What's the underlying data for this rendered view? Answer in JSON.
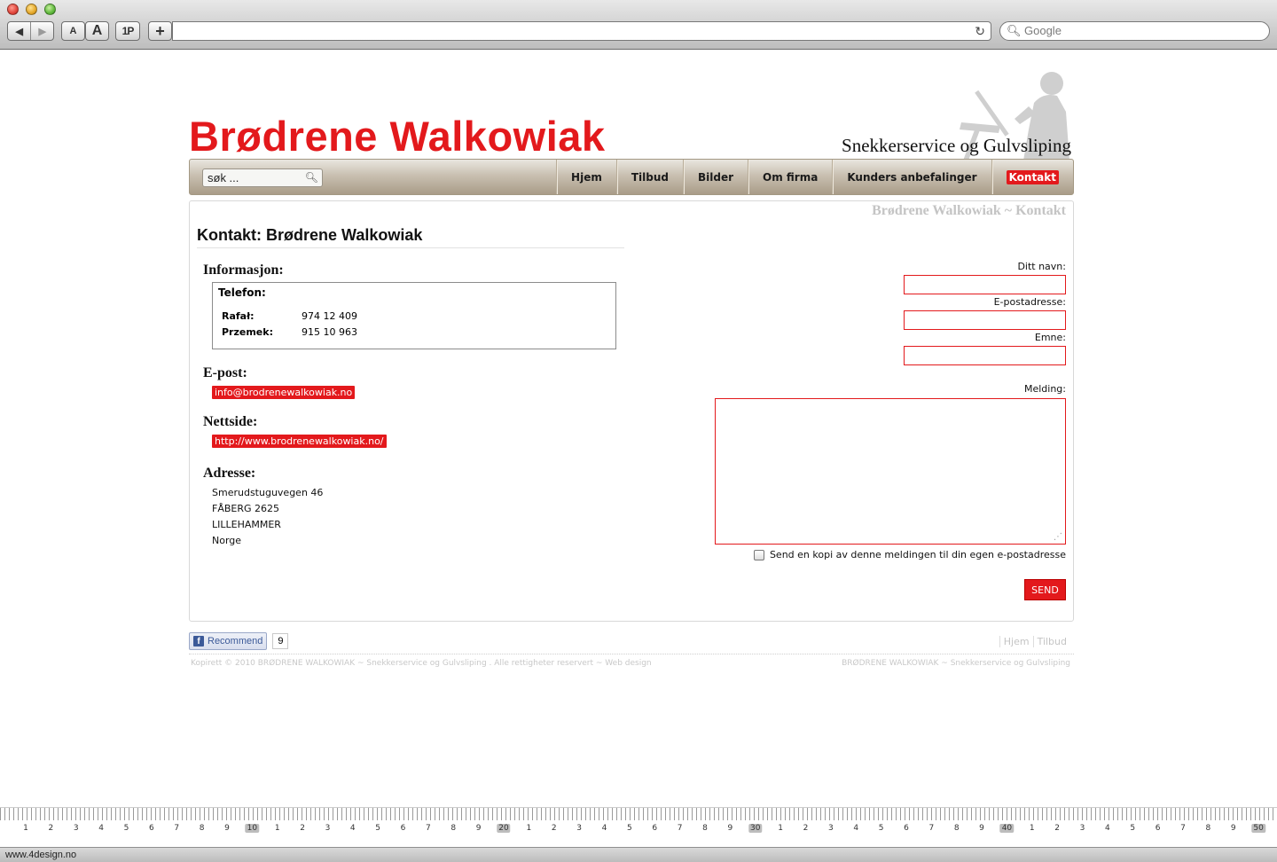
{
  "browser": {
    "search_placeholder": "Google",
    "text_smaller": "A",
    "text_bigger": "A",
    "onepassword": "1P",
    "new_tab": "+",
    "status_url": "www.4design.no"
  },
  "site": {
    "logo": "Brødrene Walkowiak",
    "tagline": "Snekkerservice og Gulvsliping",
    "search_value": "søk ...",
    "menu": [
      {
        "label": "Hjem",
        "active": false
      },
      {
        "label": "Tilbud",
        "active": false
      },
      {
        "label": "Bilder",
        "active": false
      },
      {
        "label": "Om firma",
        "active": false
      },
      {
        "label": "Kunders anbefalinger",
        "active": false
      },
      {
        "label": "Kontakt",
        "active": true
      }
    ],
    "accent_color": "#e3191c"
  },
  "content": {
    "breadcrumb": "Brødrene Walkowiak ~ Kontakt",
    "title": "Kontakt: Brødrene Walkowiak",
    "info_heading": "Informasjon:",
    "phone_heading": "Telefon:",
    "phones": [
      {
        "name": "Rafał:",
        "number": "974 12 409"
      },
      {
        "name": "Przemek:",
        "number": "915 10 963"
      }
    ],
    "email_heading": "E-post:",
    "email": "info@brodrenewalkowiak.no",
    "web_heading": "Nettside:",
    "website": "http://www.brodrenewalkowiak.no/",
    "address_heading": "Adresse:",
    "address_lines": [
      "Smerudstuguvegen 46",
      "FÅBERG 2625",
      "LILLEHAMMER",
      "Norge"
    ]
  },
  "form": {
    "name_label": "Ditt navn:",
    "email_label": "E-postadresse:",
    "subject_label": "Emne:",
    "message_label": "Melding:",
    "copy_label": "Send en kopi av denne meldingen til din egen e-postadresse",
    "send_label": "SEND"
  },
  "footer": {
    "fb_label": "Recommend",
    "fb_count": "9",
    "nav": [
      "Hjem",
      "Tilbud"
    ],
    "left": "Kopirett © 2010  BRØDRENE WALKOWIAK  ~  Snekkerservice og Gulvsliping . Alle rettigheter reservert  ~  Web design",
    "right": "BRØDRENE WALKOWIAK  ~  Snekkerservice og Gulvsliping"
  },
  "ruler": {
    "labels": [
      "1",
      "2",
      "3",
      "4",
      "5",
      "6",
      "7",
      "8",
      "9",
      "10",
      "1",
      "2",
      "3",
      "4",
      "5",
      "6",
      "7",
      "8",
      "9",
      "20",
      "1",
      "2",
      "3",
      "4",
      "5",
      "6",
      "7",
      "8",
      "9",
      "30",
      "1",
      "2",
      "3",
      "4",
      "5",
      "6",
      "7",
      "8",
      "9",
      "40",
      "1",
      "2",
      "3",
      "4",
      "5",
      "6",
      "7",
      "8",
      "9",
      "50"
    ]
  }
}
